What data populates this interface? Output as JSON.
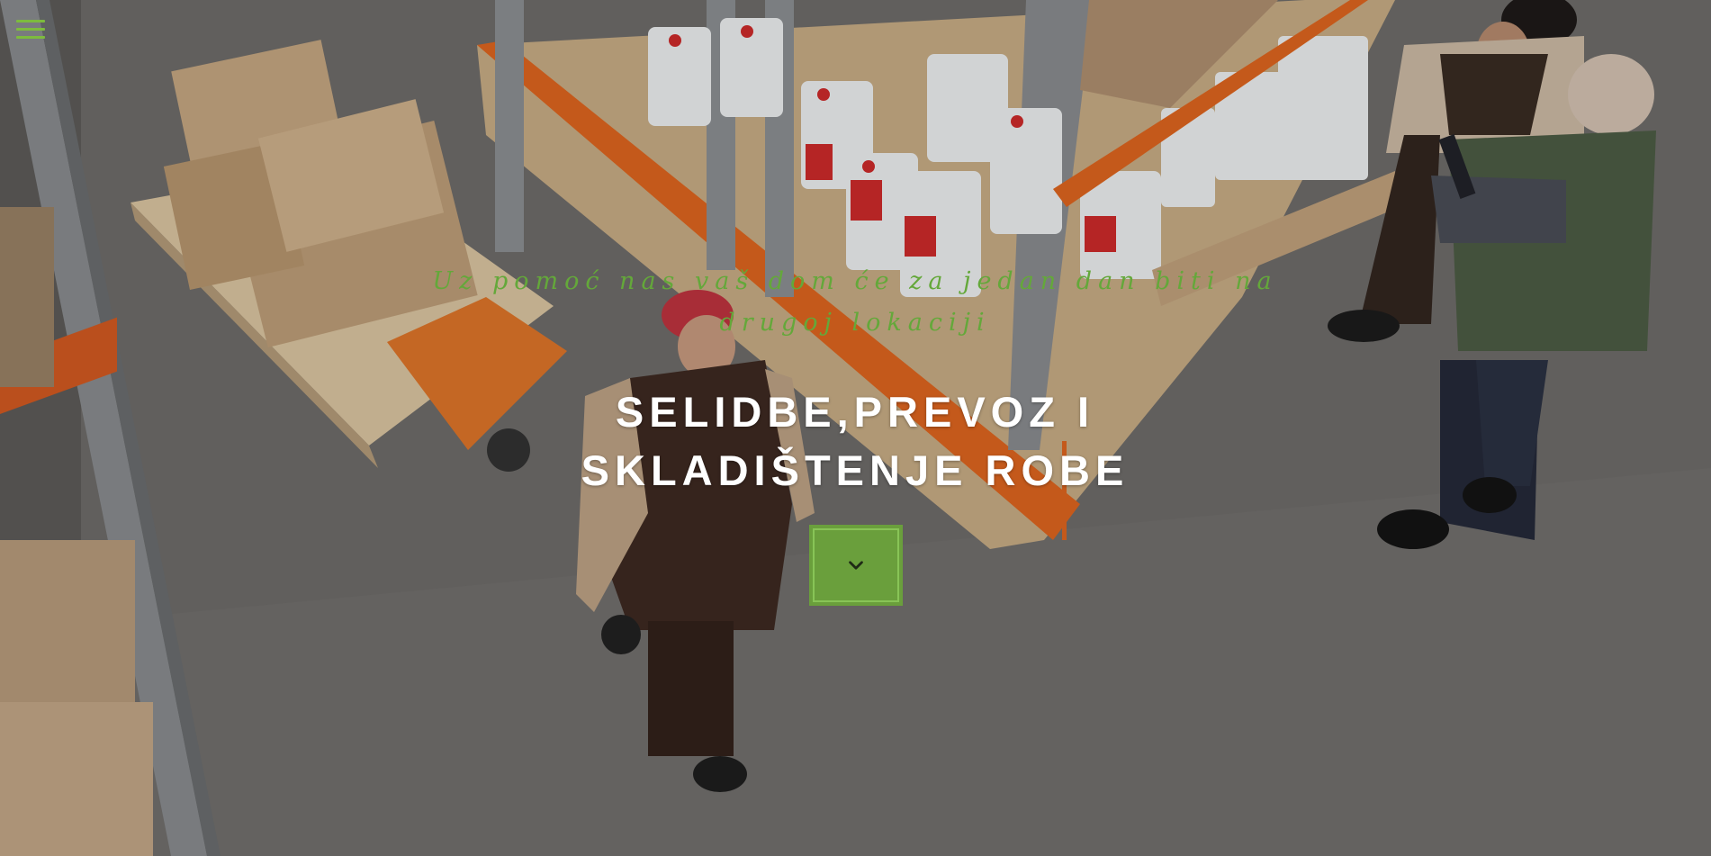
{
  "menu": {
    "icon": "hamburger-menu-icon",
    "color": "#7dbb3e"
  },
  "hero": {
    "tagline": "Uz pomoć nas vaš dom će za jedan dan biti na drugoj lokaciji",
    "title_line1": "SELIDBE,PREVOZ I",
    "title_line2": "SKLADIŠTENJE ROBE",
    "scroll_button_icon": "chevron-down-icon",
    "accent_color": "#6a9f3c"
  }
}
